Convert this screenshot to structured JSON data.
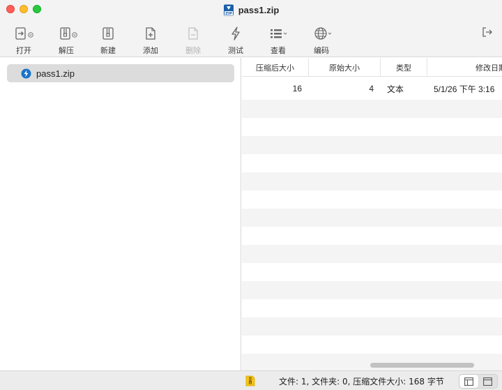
{
  "window": {
    "title": "pass1.zip"
  },
  "toolbar": {
    "items": [
      {
        "label": "打开",
        "icon": "open-icon",
        "has_menu": true
      },
      {
        "label": "解压",
        "icon": "extract-icon",
        "has_menu": true
      },
      {
        "label": "新建",
        "icon": "new-archive-icon",
        "has_menu": false
      },
      {
        "label": "添加",
        "icon": "add-file-icon",
        "has_menu": false
      },
      {
        "label": "删除",
        "icon": "delete-file-icon",
        "has_menu": false,
        "disabled": true
      },
      {
        "label": "测试",
        "icon": "test-icon",
        "has_menu": false
      },
      {
        "label": "查看",
        "icon": "view-list-icon",
        "has_menu": true
      },
      {
        "label": "编码",
        "icon": "globe-icon",
        "has_menu": true
      }
    ],
    "exit_icon": "exit-icon"
  },
  "sidebar": {
    "items": [
      {
        "label": "pass1.zip",
        "icon": "zip-archive-icon",
        "selected": true
      }
    ]
  },
  "table": {
    "columns": [
      "压缩后大小",
      "原始大小",
      "类型",
      "修改日期"
    ],
    "rows": [
      {
        "compressed": "16",
        "original": "4",
        "type": "文本",
        "modified": "5/1/26 下午 3:16"
      }
    ]
  },
  "status": {
    "text": "文件: 1, 文件夹: 0, 压缩文件大小: 168 字节"
  },
  "colors": {
    "close": "#ff5f57",
    "minimize": "#febc2e",
    "maximize": "#28c840",
    "selection": "#dcdcdc",
    "accent": "#1a73c9"
  }
}
